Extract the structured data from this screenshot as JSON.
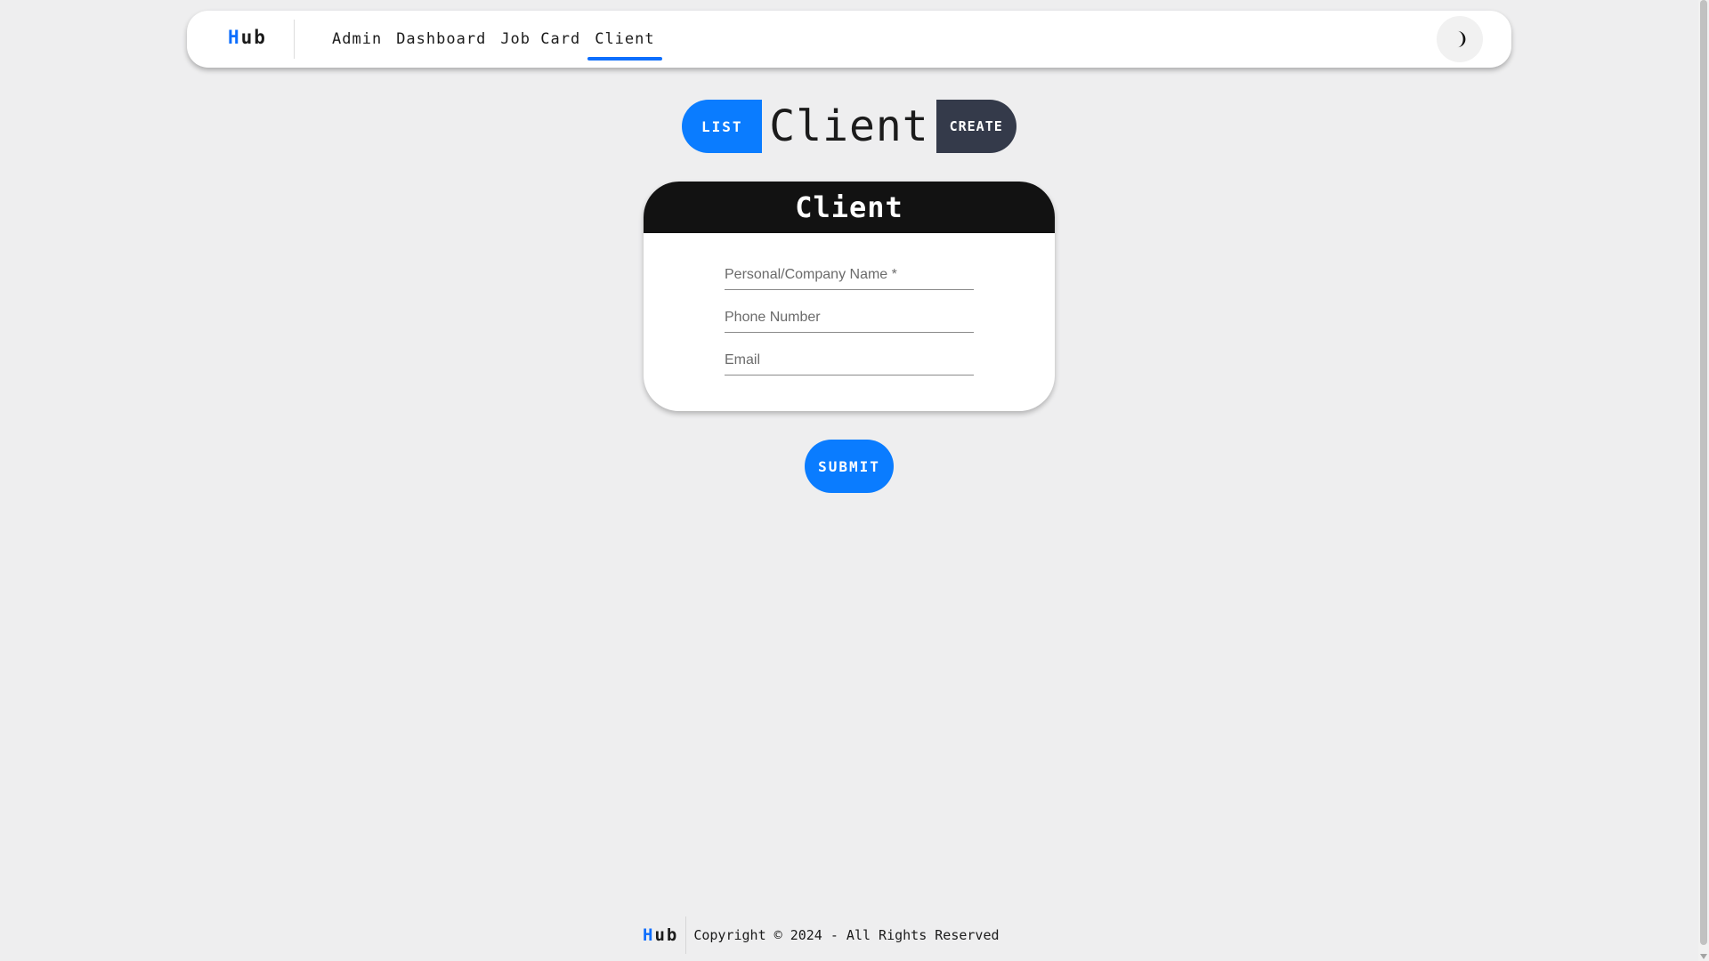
{
  "navbar": {
    "brand_first": "H",
    "brand_rest": "ub",
    "links": [
      {
        "label": "Admin"
      },
      {
        "label": "Dashboard"
      },
      {
        "label": "Job Card"
      },
      {
        "label": "Client"
      }
    ],
    "active_link": "Client",
    "theme_toggle_icon": "moon-icon"
  },
  "heading": {
    "list_label": "LIST",
    "title": "Client",
    "create_label": "CREATE"
  },
  "form": {
    "header": "Client",
    "fields": [
      {
        "placeholder": "Personal/Company Name *",
        "value": ""
      },
      {
        "placeholder": "Phone Number",
        "value": ""
      },
      {
        "placeholder": "Email",
        "value": ""
      }
    ],
    "submit_label": "SUBMIT"
  },
  "footer": {
    "brand_first": "H",
    "brand_rest": "ub",
    "copyright": "Copyright © 2024 - All Rights Reserved"
  },
  "colors": {
    "accent": "#0a7cff",
    "dark_button": "#343a4a",
    "card_header": "#121212",
    "background": "#eeeeef"
  }
}
